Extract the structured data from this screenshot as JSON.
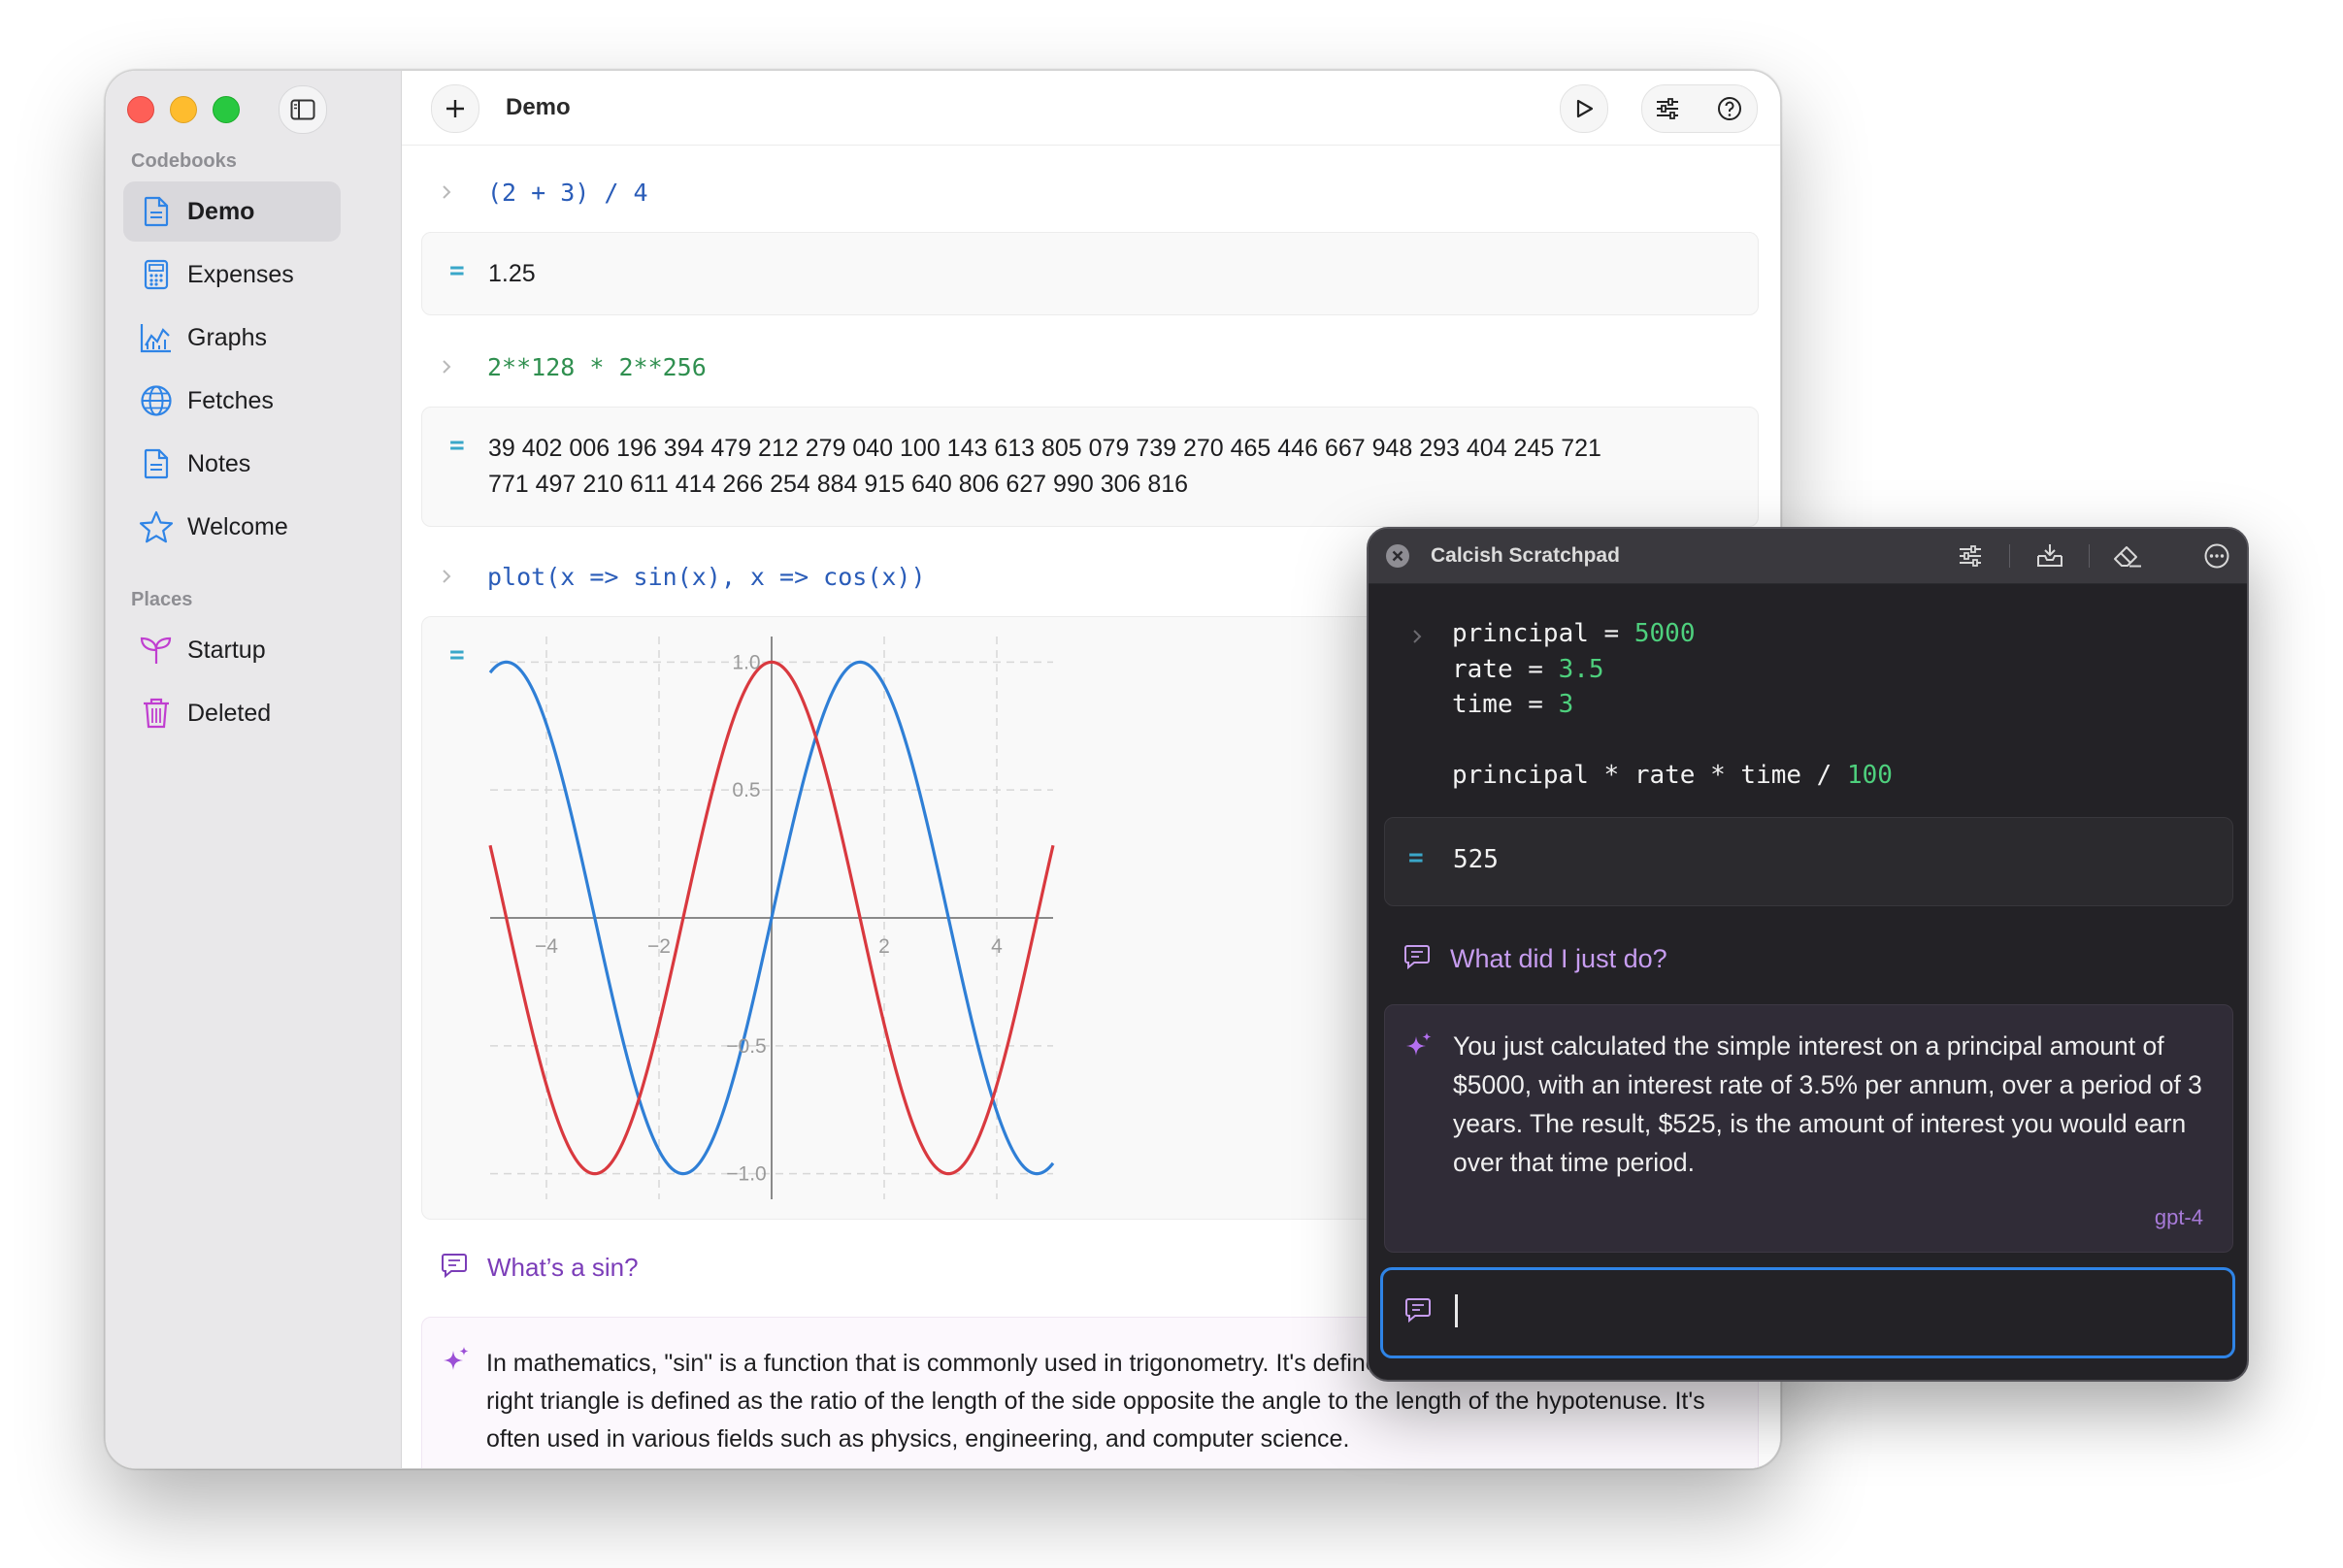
{
  "sidebar": {
    "codebooks_heading": "Codebooks",
    "places_heading": "Places",
    "items": [
      {
        "label": "Demo",
        "icon": "document-icon"
      },
      {
        "label": "Expenses",
        "icon": "calculator-icon"
      },
      {
        "label": "Graphs",
        "icon": "chart-icon"
      },
      {
        "label": "Fetches",
        "icon": "globe-icon"
      },
      {
        "label": "Notes",
        "icon": "document-icon"
      },
      {
        "label": "Welcome",
        "icon": "star-icon"
      }
    ],
    "places": [
      {
        "label": "Startup",
        "icon": "sprout-icon"
      },
      {
        "label": "Deleted",
        "icon": "trash-icon"
      }
    ]
  },
  "toolbar": {
    "title": "Demo"
  },
  "cells": [
    {
      "input_a": "(2 + 3) / 4",
      "output": "1.25"
    },
    {
      "input_a": "2**128 * 2**256",
      "output_line1": "39 402 006 196 394 479 212 279 040 100 143 613 805 079 739 270 465 446 667 948 293 404 245 721",
      "output_line2": "771 497 210 611 414 266 254 884 915 640 806 627 990 306 816"
    },
    {
      "input_a": "plot(x => sin(x), x => cos(x))"
    }
  ],
  "ai": {
    "question": "What’s a sin?",
    "answer": "In mathematics, \"sin\" is a function that is commonly used in trigonometry. It's defined as: the sine of an angle in a right triangle is defined as the ratio of the length of the side opposite the angle to the length of the hypotenuse. It's often used in various fields such as physics, engineering, and computer science."
  },
  "chart_data": {
    "type": "line",
    "xlim": [
      -5,
      5
    ],
    "ylim": [
      -1.1,
      1.1
    ],
    "x_ticks": [
      "−4",
      "−2",
      "2",
      "4"
    ],
    "y_ticks": [
      "1.0",
      "0.5",
      "−0.5",
      "−1.0"
    ],
    "grid": true,
    "series": [
      {
        "function": "sin(x)",
        "color": "#2f7fd6"
      },
      {
        "function": "cos(x)",
        "color": "#d9393f"
      }
    ]
  },
  "scratchpad": {
    "title": "Calcish Scratchpad",
    "code": {
      "l1_name": "principal",
      "l1_op": " = ",
      "l1_val": "5000",
      "l2_name": "rate",
      "l2_op": " = ",
      "l2_val": "3.5",
      "l3_name": "time",
      "l3_op": " = ",
      "l3_val": "3",
      "l5_expr": "principal * rate * time / ",
      "l5_val": "100"
    },
    "result": "525",
    "question": "What did I just do?",
    "answer": "You just calculated the simple interest on a principal amount of $5000, with an interest rate of 3.5% per annum, over a period of 3 years. The result, $525, is the amount of interest you would earn over that time period.",
    "model": "gpt-4",
    "input_value": ""
  },
  "colors": {
    "accent_blue": "#2f84e6",
    "ai_purple": "#7b3db8",
    "number_green": "#2f8f4f",
    "equals_teal": "#3aa7c9"
  }
}
